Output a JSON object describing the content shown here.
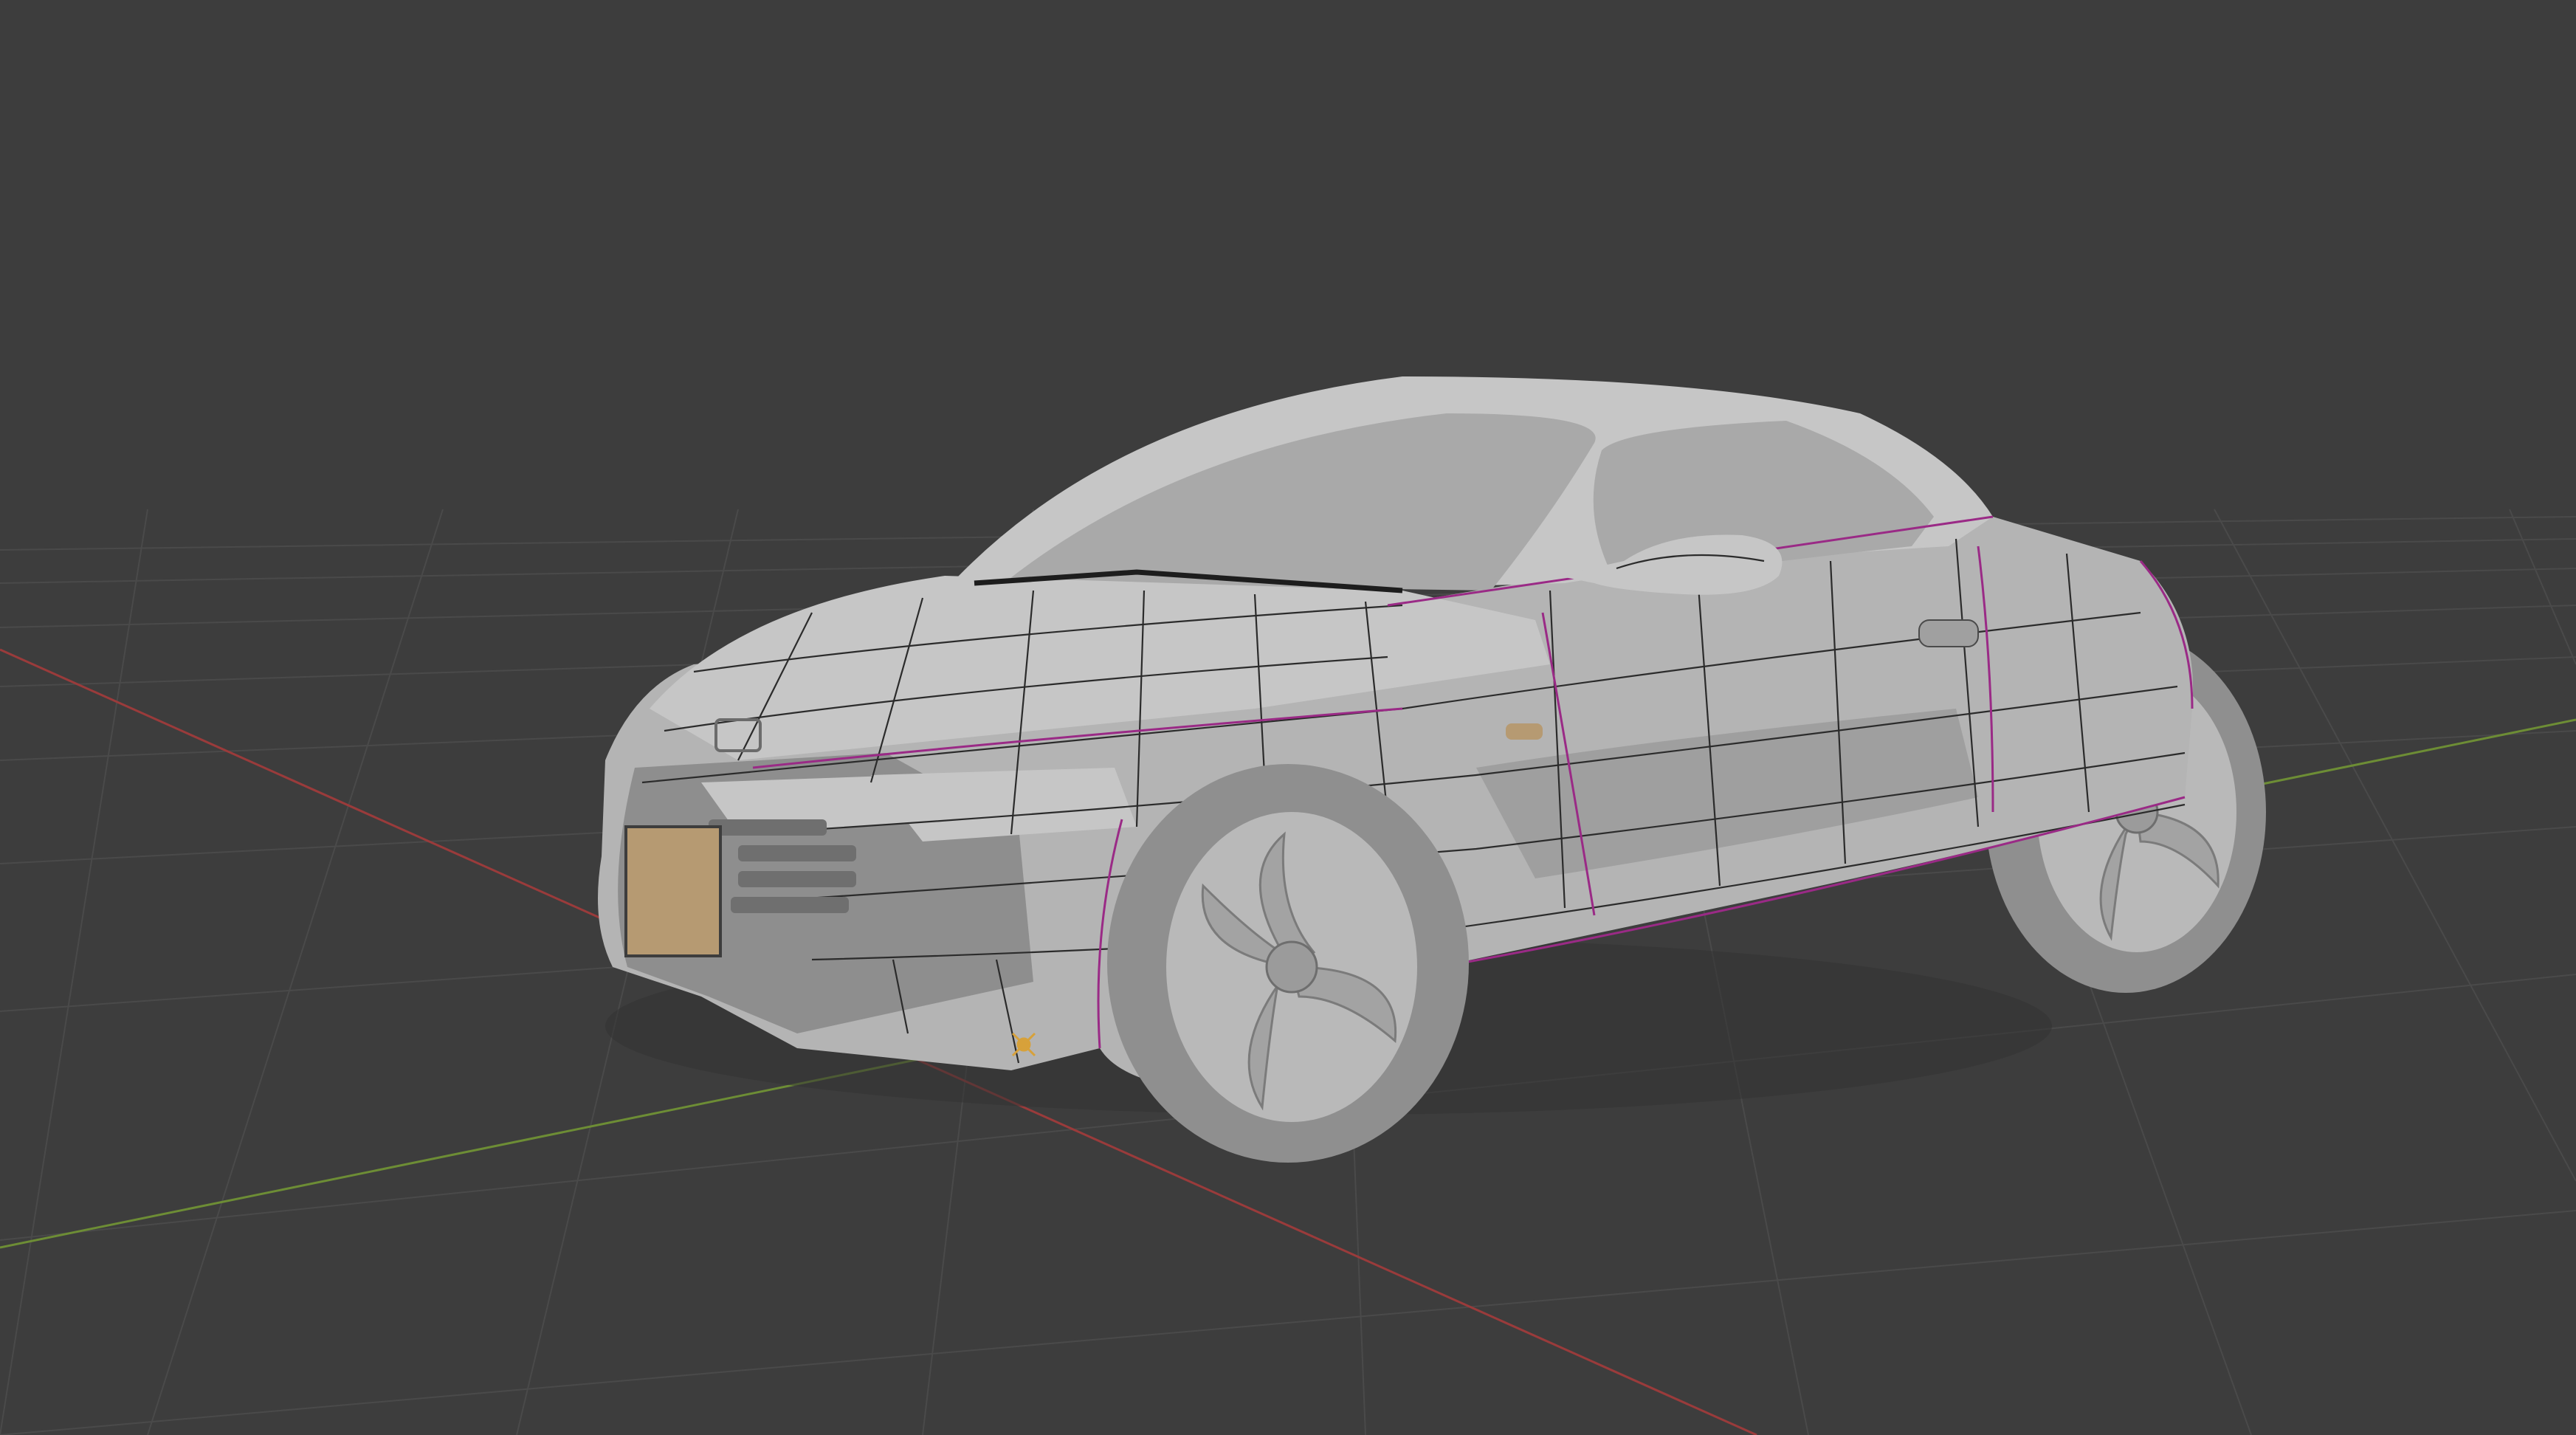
{
  "app": {
    "name": "",
    "mode": "3D viewport",
    "shading": "solid"
  },
  "viewport": {
    "background_color": "#3d3d3d",
    "grid_color": "#4a4a4a",
    "x_axis_color": "#9a3b3b",
    "y_axis_color": "#6d8d35",
    "grid": true
  },
  "objects": [
    {
      "name": "car-body-mesh",
      "type": "mesh"
    },
    {
      "name": "front-left-wheel",
      "type": "mesh"
    },
    {
      "name": "rear-left-wheel",
      "type": "mesh"
    },
    {
      "name": "side-mirror",
      "type": "mesh"
    },
    {
      "name": "license-plate",
      "type": "mesh"
    },
    {
      "name": "object-origin",
      "type": "empty"
    }
  ],
  "colors": {
    "body": "#b4b4b4",
    "seam": "#9a2a86",
    "wire": "#2b2b2b",
    "plate": "#b69a72"
  }
}
